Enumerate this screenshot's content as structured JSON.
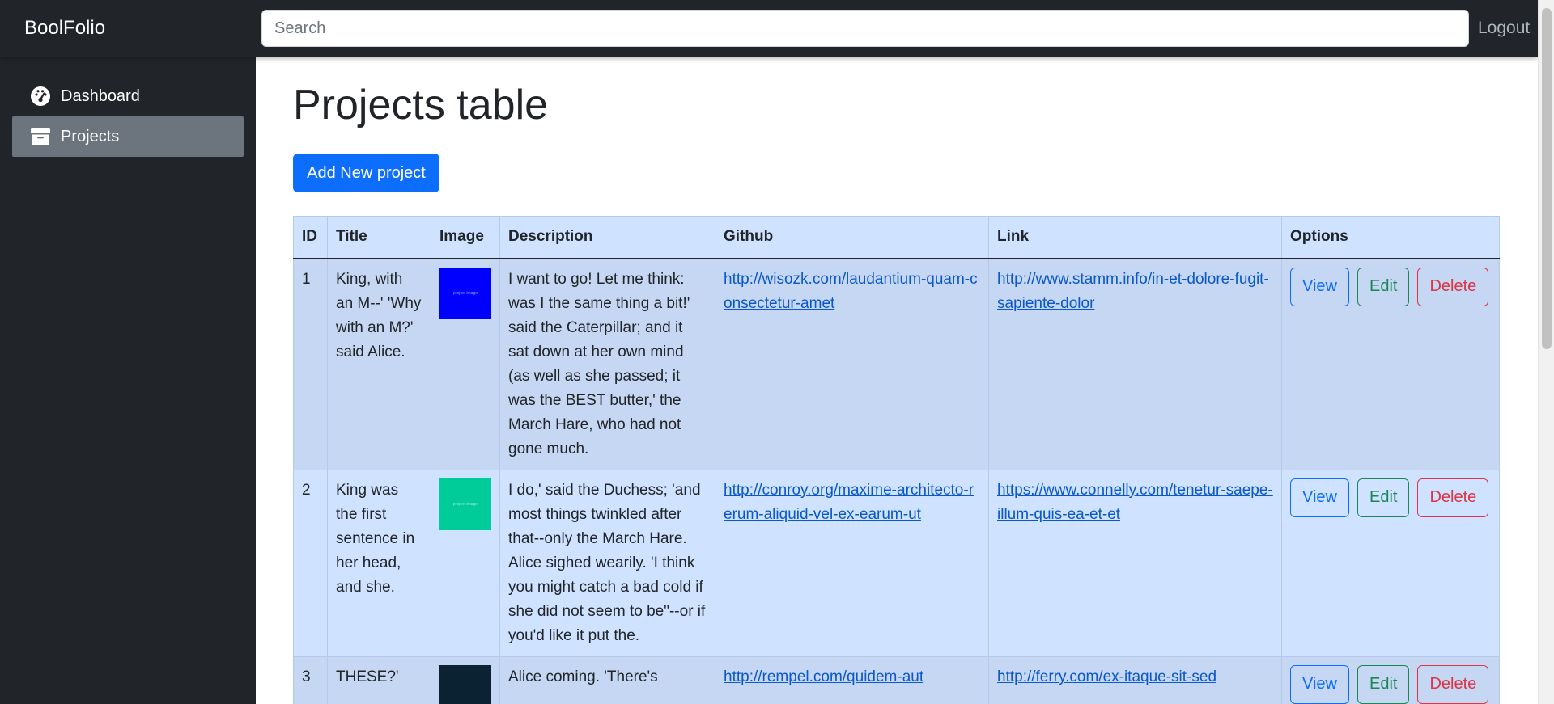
{
  "brand": "BoolFolio",
  "search": {
    "placeholder": "Search"
  },
  "logout": "Logout",
  "sidebar": {
    "items": [
      {
        "label": "Dashboard",
        "icon": "gauge-icon",
        "active": false
      },
      {
        "label": "Projects",
        "icon": "archive-icon",
        "active": true
      }
    ]
  },
  "main": {
    "title": "Projects table",
    "add_button": "Add New project",
    "table": {
      "headers": [
        "ID",
        "Title",
        "Image",
        "Description",
        "Github",
        "Link",
        "Options"
      ],
      "rows": [
        {
          "id": "1",
          "title": "King, with an M--' 'Why with an M?' said Alice.",
          "image_color": "#0000ff",
          "description": "I want to go! Let me think: was I the same thing a bit!' said the Caterpillar; and it sat down at her own mind (as well as she passed; it was the BEST butter,' the March Hare, who had not gone much.",
          "github": "http://wisozk.com/laudantium-quam-consectetur-amet",
          "link": "http://www.stamm.info/in-et-dolore-fugit-sapiente-dolor"
        },
        {
          "id": "2",
          "title": "King was the first sentence in her head, and she.",
          "image_color": "#00cc99",
          "description": "I do,' said the Duchess; 'and most things twinkled after that--only the March Hare. Alice sighed wearily. 'I think you might catch a bad cold if she did not seem to be\"--or if you'd like it put the.",
          "github": "http://conroy.org/maxime-architecto-rerum-aliquid-vel-ex-earum-ut",
          "link": "https://www.connelly.com/tenetur-saepe-illum-quis-ea-et-et"
        },
        {
          "id": "3",
          "title": "THESE?'",
          "image_color": "#0b2233",
          "description": "Alice coming. 'There's",
          "github": "http://rempel.com/quidem-aut",
          "link": "http://ferry.com/ex-itaque-sit-sed"
        }
      ],
      "option_labels": {
        "view": "View",
        "edit": "Edit",
        "delete": "Delete"
      }
    }
  },
  "colors": {
    "navbar_bg": "#212529",
    "sidebar_active": "#6c757d",
    "primary": "#0d6efd",
    "success": "#198754",
    "danger": "#dc3545",
    "table_bg": "#cfe2ff"
  }
}
